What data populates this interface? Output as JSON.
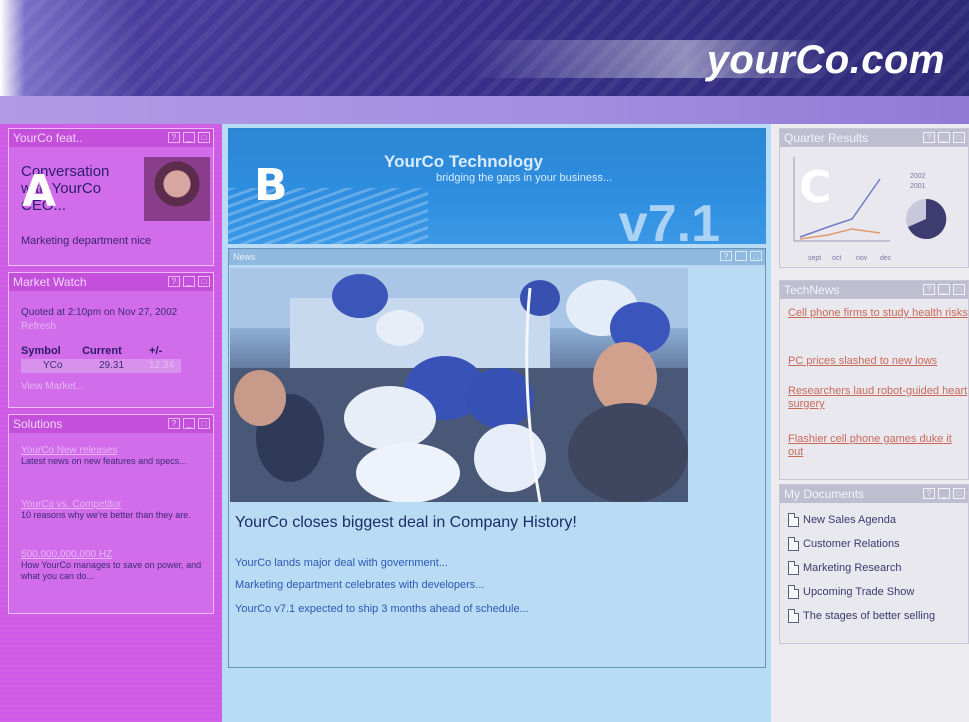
{
  "header": {
    "site_name": "yourCo.com"
  },
  "zones": {
    "a": "A",
    "b": "B",
    "c": "C"
  },
  "window_controls": {
    "help": "?",
    "minimize": "_",
    "maximize": "□"
  },
  "column_a": {
    "featured": {
      "title": "YourCo feat..",
      "story": "Conversation with YourCo CEO...",
      "link": "Marketing department nice"
    },
    "market_watch": {
      "title": "Market Watch",
      "quoted": "Quoted at 2:10pm on Nov 27, 2002",
      "refresh": "Refresh",
      "col_symbol": "Symbol",
      "col_current": "Current",
      "col_change": "+/-",
      "row": {
        "symbol": "YCo",
        "current": "29.31",
        "change": "12.34"
      },
      "view_market": "View Market..."
    },
    "solutions": {
      "title": "Solutions",
      "items": [
        {
          "link": "YourCo New releases",
          "desc": "Latest news on new features and specs..."
        },
        {
          "link": "YourCo vs. Competitor",
          "desc": "10 reasons why we're better than they are."
        },
        {
          "link": "500,000,000,000 HZ",
          "desc": "How YourCo manages to save on power, and what you can do..."
        }
      ]
    }
  },
  "column_b": {
    "banner": {
      "title": "YourCo Technology",
      "subtitle": "bridging the gaps in your business...",
      "version": "v7.1"
    },
    "news": {
      "title": "News",
      "headline": "YourCo closes biggest deal in Company History!",
      "links": [
        "YourCo lands major deal with government...",
        "Marketing department celebrates with developers...",
        "YourCo v7.1 expected to ship 3 months ahead of schedule..."
      ]
    }
  },
  "column_c": {
    "quarter_results": {
      "title": "Quarter Results",
      "legend": [
        "2002",
        "2001"
      ],
      "x_labels": [
        "sept",
        "oct",
        "nov",
        "dec"
      ],
      "colors": {
        "line_a": "#6c7dc4",
        "line_b": "#e09a6a",
        "pie_main": "#3c3c70",
        "pie_rest": "#c8c8dc"
      }
    },
    "tech_news": {
      "title": "TechNews",
      "links": [
        "Cell phone firms to study health risks",
        "PC prices slashed to new lows",
        "Researchers laud robot-guided heart surgery",
        "Flashier cell phone games duke it out"
      ]
    },
    "documents": {
      "title": "My Documents",
      "items": [
        "New Sales Agenda",
        "Customer Relations",
        "Marketing Research",
        "Upcoming Trade Show",
        "The stages of better selling"
      ]
    }
  }
}
